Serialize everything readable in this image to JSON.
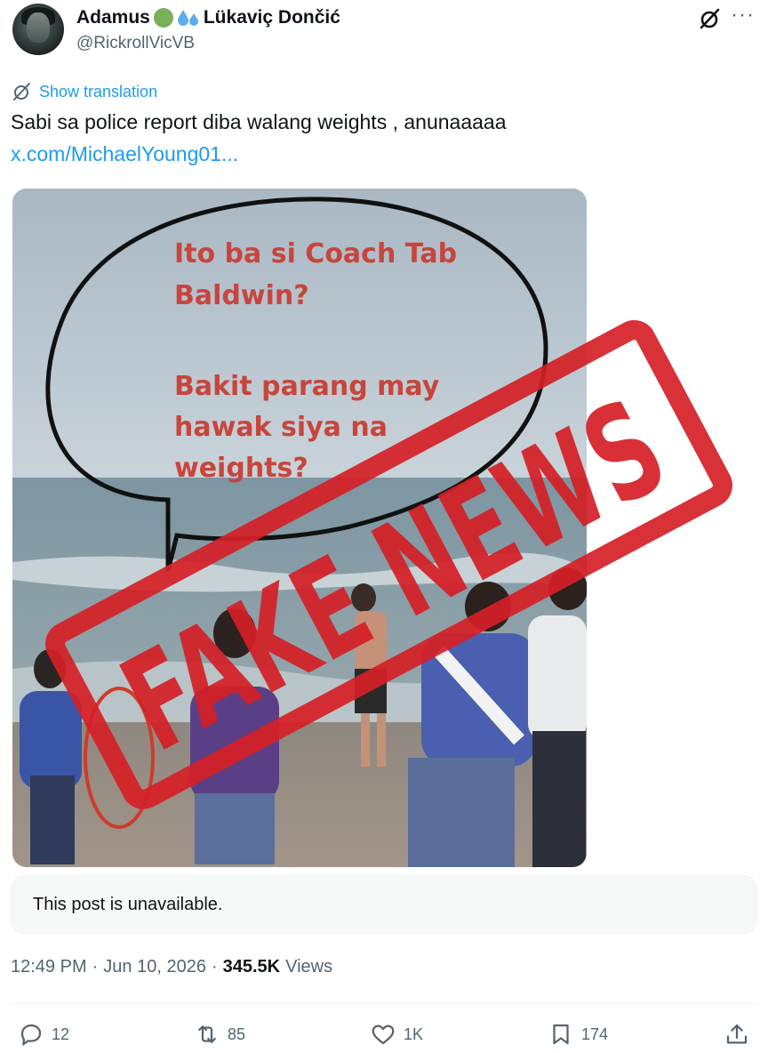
{
  "author": {
    "display_name": "Adamus",
    "display_name_suffix": "Lükaviç Dončić",
    "handle": "@RickrollVicVB"
  },
  "translate": {
    "label": "Show translation"
  },
  "tweet": {
    "text": "Sabi sa police report diba walang weights , anunaaaaa",
    "link": "x.com/MichaelYoung01..."
  },
  "media": {
    "bubble_line1": "Ito ba si Coach Tab",
    "bubble_line2": "Baldwin?",
    "bubble_line3": "Bakit parang may",
    "bubble_line4": "hawak siya na",
    "bubble_line5": "weights?",
    "stamp_text": "FAKE NEWS",
    "stamp_color": "#d51f26",
    "bubble_text_color": "#c8453c"
  },
  "quote": {
    "unavailable_text": "This post is unavailable."
  },
  "meta": {
    "time": "12:49 PM",
    "separator": "·",
    "date": "Jun 10, 2026",
    "views_count": "345.5K",
    "views_label": "Views"
  },
  "actions": {
    "replies": "12",
    "reposts": "85",
    "likes": "1K",
    "bookmarks": "174"
  },
  "colors": {
    "accent": "#1d9bf0",
    "secondary_text": "#536471",
    "primary_text": "#0f1419"
  }
}
